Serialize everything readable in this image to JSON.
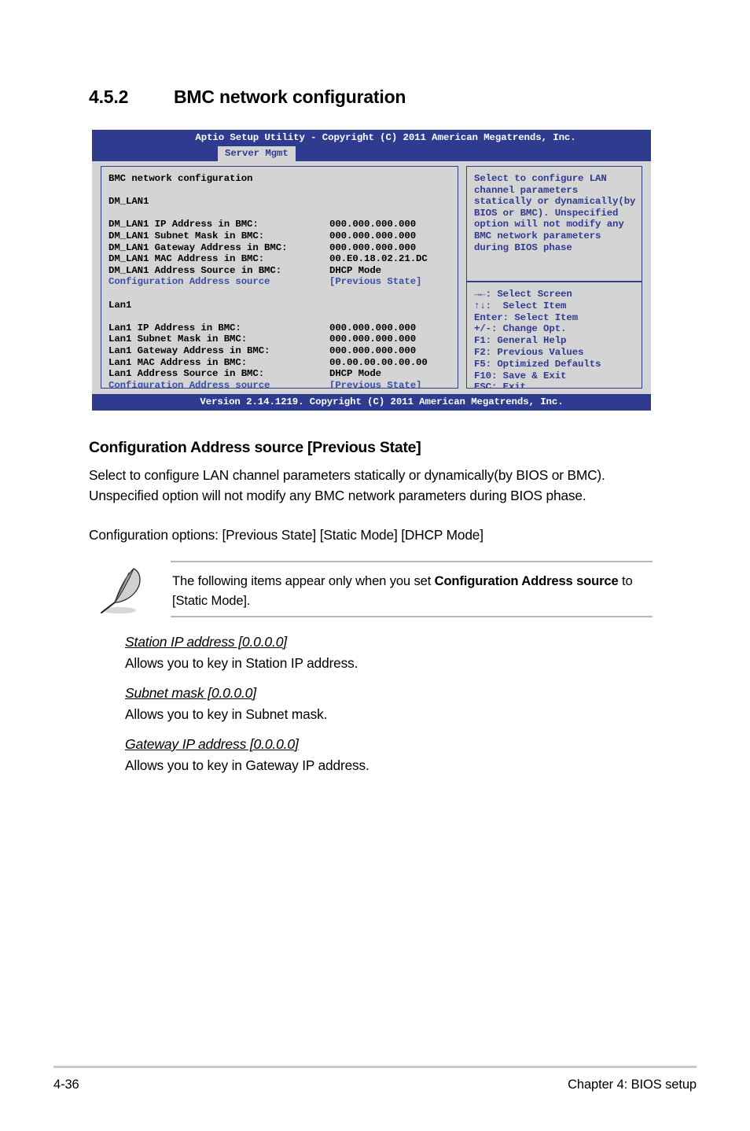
{
  "section": {
    "number": "4.5.2",
    "title": "BMC network configuration"
  },
  "bios": {
    "title_bar": "Aptio Setup Utility - Copyright (C) 2011 American Megatrends, Inc.",
    "active_tab": "Server Mgmt",
    "screen_title": "BMC network configuration",
    "groups": [
      {
        "name": "DM_LAN1",
        "rows": [
          {
            "label": "DM_LAN1 IP Address in BMC:",
            "value": "000.000.000.000"
          },
          {
            "label": "DM_LAN1 Subnet Mask in BMC:",
            "value": "000.000.000.000"
          },
          {
            "label": "DM_LAN1 Gateway Address in BMC:",
            "value": "000.000.000.000"
          },
          {
            "label": "DM_LAN1 MAC Address in BMC:",
            "value": "00.E0.18.02.21.DC"
          },
          {
            "label": "DM_LAN1 Address Source in BMC:",
            "value": "DHCP Mode"
          }
        ],
        "setting": {
          "label": "Configuration Address source",
          "value": "[Previous State]"
        }
      },
      {
        "name": "Lan1",
        "rows": [
          {
            "label": "Lan1 IP Address in BMC:",
            "value": "000.000.000.000"
          },
          {
            "label": "Lan1 Subnet Mask in BMC:",
            "value": "000.000.000.000"
          },
          {
            "label": "Lan1 Gateway Address in BMC:",
            "value": "000.000.000.000"
          },
          {
            "label": "Lan1 MAC Address in BMC:",
            "value": "00.00.00.00.00.00"
          },
          {
            "label": "Lan1 Address Source in BMC:",
            "value": "DHCP Mode"
          }
        ],
        "setting": {
          "label": "Configuration Address source",
          "value": "[Previous State]"
        }
      }
    ],
    "help_text": [
      "Select to configure LAN",
      "channel parameters",
      "statically or dynamically(by",
      "BIOS or BMC). Unspecified",
      "option will not modify any",
      "BMC network parameters",
      "during BIOS phase"
    ],
    "legend": [
      "→←: Select Screen",
      "↑↓:  Select Item",
      "Enter: Select Item",
      "+/-: Change Opt.",
      "F1: General Help",
      "F2: Previous Values",
      "F5: Optimized Defaults",
      "F10: Save & Exit",
      "ESC: Exit"
    ],
    "footer_bar": "Version 2.14.1219. Copyright (C) 2011 American Megatrends, Inc.",
    "colors": {
      "chrome": "#2e3b8f",
      "panel_background": "#d4d4d4",
      "accent_text": "#3a4fa8"
    }
  },
  "doc": {
    "setting_heading": "Configuration Address source [Previous State]",
    "setting_paragraph": "Select to configure LAN channel parameters statically or dynamically(by BIOS or BMC). Unspecified option will not modify any BMC network parameters during BIOS phase.",
    "setting_options_line": "Configuration options: [Previous State] [Static Mode] [DHCP Mode]",
    "note": {
      "text_before": "The following items appear only when you set ",
      "text_bold": "Configuration Address source",
      "text_after": " to [Static Mode]."
    },
    "items": [
      {
        "title": "Station IP address [0.0.0.0]",
        "description": "Allows you to key in Station IP address."
      },
      {
        "title": "Subnet mask [0.0.0.0]",
        "description": "Allows you to key in Subnet mask."
      },
      {
        "title": "Gateway IP address [0.0.0.0]",
        "description": "Allows you to key in Gateway IP address."
      }
    ]
  },
  "page_footer": {
    "page_number": "4-36",
    "chapter": "Chapter 4: BIOS setup"
  }
}
